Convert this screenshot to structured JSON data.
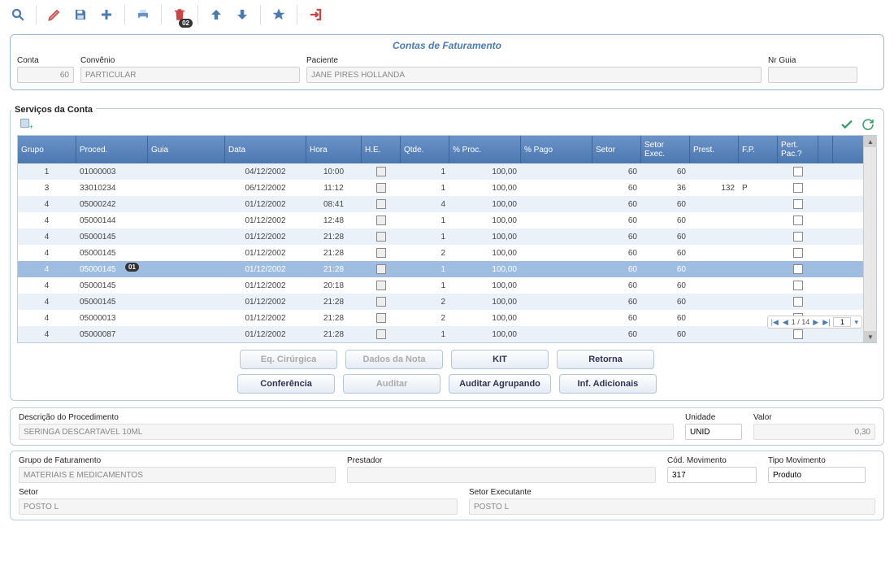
{
  "toolbar_badges": {
    "trash": "02"
  },
  "panel_title": "Contas de Faturamento",
  "header": {
    "conta_label": "Conta",
    "conta_value": "60",
    "convenio_label": "Convênio",
    "convenio_value": "PARTICULAR",
    "paciente_label": "Paciente",
    "paciente_value": "JANE PIRES HOLLANDA",
    "nrguia_label": "Nr Guia",
    "nrguia_value": ""
  },
  "section_title": "Serviços da Conta",
  "columns": [
    "Grupo",
    "Proced.",
    "Guia",
    "Data",
    "Hora",
    "H.E.",
    "Qtde.",
    "% Proc.",
    "% Pago",
    "Setor",
    "Setor Exec.",
    "Prest.",
    "F.P.",
    "Pert. Pac.?"
  ],
  "rows": [
    {
      "grupo": "1",
      "proced": "01000003",
      "guia": "",
      "data": "04/12/2002",
      "hora": "10:00",
      "he": "",
      "qtde": "1",
      "pproc": "100,00",
      "ppago": "",
      "setor": "60",
      "setorex": "60",
      "prest": "",
      "fp": "",
      "sel": false
    },
    {
      "grupo": "3",
      "proced": "33010234",
      "guia": "",
      "data": "06/12/2002",
      "hora": "11:12",
      "he": "",
      "qtde": "1",
      "pproc": "100,00",
      "ppago": "",
      "setor": "60",
      "setorex": "36",
      "prest": "132",
      "fp": "P",
      "sel": false
    },
    {
      "grupo": "4",
      "proced": "05000242",
      "guia": "",
      "data": "01/12/2002",
      "hora": "08:41",
      "he": "",
      "qtde": "4",
      "pproc": "100,00",
      "ppago": "",
      "setor": "60",
      "setorex": "60",
      "prest": "",
      "fp": "",
      "sel": false
    },
    {
      "grupo": "4",
      "proced": "05000144",
      "guia": "",
      "data": "01/12/2002",
      "hora": "12:48",
      "he": "",
      "qtde": "1",
      "pproc": "100,00",
      "ppago": "",
      "setor": "60",
      "setorex": "60",
      "prest": "",
      "fp": "",
      "sel": false
    },
    {
      "grupo": "4",
      "proced": "05000145",
      "guia": "",
      "data": "01/12/2002",
      "hora": "21:28",
      "he": "",
      "qtde": "1",
      "pproc": "100,00",
      "ppago": "",
      "setor": "60",
      "setorex": "60",
      "prest": "",
      "fp": "",
      "sel": false
    },
    {
      "grupo": "4",
      "proced": "05000145",
      "guia": "",
      "data": "01/12/2002",
      "hora": "21:28",
      "he": "",
      "qtde": "2",
      "pproc": "100,00",
      "ppago": "",
      "setor": "60",
      "setorex": "60",
      "prest": "",
      "fp": "",
      "sel": false
    },
    {
      "grupo": "4",
      "proced": "05000145",
      "guia": "",
      "data": "01/12/2002",
      "hora": "21:28",
      "he": "",
      "qtde": "1",
      "pproc": "100,00",
      "ppago": "",
      "setor": "60",
      "setorex": "60",
      "prest": "",
      "fp": "",
      "sel": true,
      "badge": "01"
    },
    {
      "grupo": "4",
      "proced": "05000145",
      "guia": "",
      "data": "01/12/2002",
      "hora": "20:18",
      "he": "",
      "qtde": "1",
      "pproc": "100,00",
      "ppago": "",
      "setor": "60",
      "setorex": "60",
      "prest": "",
      "fp": "",
      "sel": false
    },
    {
      "grupo": "4",
      "proced": "05000145",
      "guia": "",
      "data": "01/12/2002",
      "hora": "21:28",
      "he": "",
      "qtde": "2",
      "pproc": "100,00",
      "ppago": "",
      "setor": "60",
      "setorex": "60",
      "prest": "",
      "fp": "",
      "sel": false
    },
    {
      "grupo": "4",
      "proced": "05000013",
      "guia": "",
      "data": "01/12/2002",
      "hora": "21:28",
      "he": "",
      "qtde": "2",
      "pproc": "100,00",
      "ppago": "",
      "setor": "60",
      "setorex": "60",
      "prest": "",
      "fp": "",
      "sel": false
    },
    {
      "grupo": "4",
      "proced": "05000087",
      "guia": "",
      "data": "01/12/2002",
      "hora": "21:28",
      "he": "",
      "qtde": "1",
      "pproc": "100,00",
      "ppago": "",
      "setor": "60",
      "setorex": "60",
      "prest": "",
      "fp": "",
      "sel": false
    }
  ],
  "pager": {
    "text": "1 / 14",
    "input": "1"
  },
  "buttons": {
    "eq_cirurgica": "Eq. Cirúrgica",
    "dados_nota": "Dados da Nota",
    "kit": "KIT",
    "retorna": "Retorna",
    "conferencia": "Conferência",
    "auditar": "Auditar",
    "auditar_agrup": "Auditar Agrupando",
    "inf_adic": "Inf. Adicionais"
  },
  "detail1": {
    "desc_label": "Descrição do Procedimento",
    "desc_value": "SERINGA DESCARTAVEL 10ML",
    "unidade_label": "Unidade",
    "unidade_value": "UNID",
    "valor_label": "Valor",
    "valor_value": "0,30"
  },
  "detail2": {
    "grupo_label": "Grupo de Faturamento",
    "grupo_value": "MATERIAIS E MEDICAMENTOS",
    "prestador_label": "Prestador",
    "prestador_value": "",
    "codmov_label": "Cód. Movimento",
    "codmov_value": "317",
    "tipomov_label": "Tipo Movimento",
    "tipomov_value": "Produto",
    "setor_label": "Setor",
    "setor_value": "POSTO L",
    "setorex_label": "Setor Executante",
    "setorex_value": "POSTO L"
  }
}
